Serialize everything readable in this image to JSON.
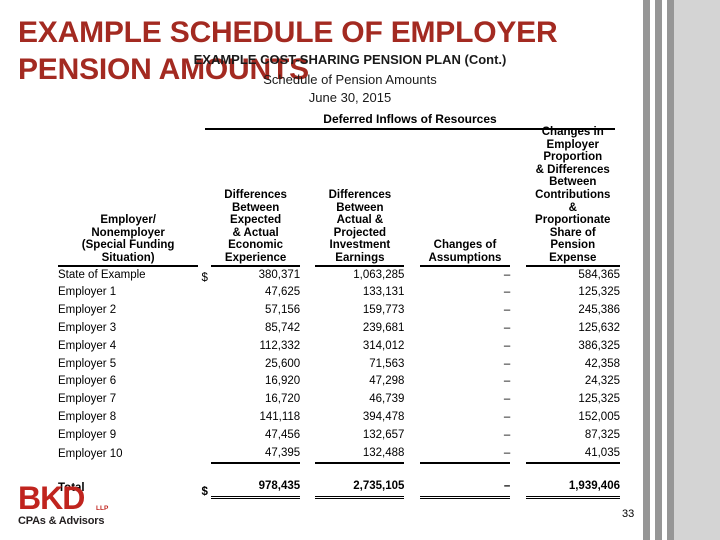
{
  "slide": {
    "title": "EXAMPLE SCHEDULE OF EMPLOYER PENSION AMOUNTS",
    "page_number": "33",
    "accent_color": "#A32A21",
    "bar_color": "#969696",
    "panel_color": "#d4d4d4"
  },
  "subheader": {
    "line1": "EXAMPLE COST-SHARING PENSION PLAN (Cont.)",
    "line2": "Schedule of Pension Amounts",
    "line3": "June 30, 2015"
  },
  "table": {
    "group_header": "Deferred Inflows of Resources",
    "columns": [
      {
        "id": "employer",
        "lines": [
          "Employer/",
          "Nonemployer",
          "(Special Funding",
          "Situation)"
        ]
      },
      {
        "id": "econ",
        "lines": [
          "Differences",
          "Between",
          "Expected",
          "& Actual",
          "Economic",
          "Experience"
        ]
      },
      {
        "id": "invest",
        "lines": [
          "Differences",
          "Between",
          "Actual &",
          "Projected",
          "Investment",
          "Earnings"
        ]
      },
      {
        "id": "assumptions",
        "lines": [
          "Changes of",
          "Assumptions"
        ]
      },
      {
        "id": "proportion",
        "lines": [
          "Changes in",
          "Employer",
          "Proportion",
          "& Differences",
          "Between",
          "Contributions",
          "&",
          "Proportionate",
          "Share of",
          "Pension",
          "Expense"
        ]
      }
    ],
    "currency_symbol": "$",
    "rows": [
      {
        "label": "State of Example",
        "currency": "$",
        "econ": "380,371",
        "invest": "1,063,285",
        "assumptions": "–",
        "proportion": "584,365"
      },
      {
        "label": "Employer 1",
        "currency": "",
        "econ": "47,625",
        "invest": "133,131",
        "assumptions": "–",
        "proportion": "125,325"
      },
      {
        "label": "Employer 2",
        "currency": "",
        "econ": "57,156",
        "invest": "159,773",
        "assumptions": "–",
        "proportion": "245,386"
      },
      {
        "label": "Employer 3",
        "currency": "",
        "econ": "85,742",
        "invest": "239,681",
        "assumptions": "–",
        "proportion": "125,632"
      },
      {
        "label": "Employer 4",
        "currency": "",
        "econ": "112,332",
        "invest": "314,012",
        "assumptions": "–",
        "proportion": "386,325"
      },
      {
        "label": "Employer 5",
        "currency": "",
        "econ": "25,600",
        "invest": "71,563",
        "assumptions": "–",
        "proportion": "42,358"
      },
      {
        "label": "Employer 6",
        "currency": "",
        "econ": "16,920",
        "invest": "47,298",
        "assumptions": "–",
        "proportion": "24,325"
      },
      {
        "label": "Employer 7",
        "currency": "",
        "econ": "16,720",
        "invest": "46,739",
        "assumptions": "–",
        "proportion": "125,325"
      },
      {
        "label": "Employer 8",
        "currency": "",
        "econ": "141,118",
        "invest": "394,478",
        "assumptions": "–",
        "proportion": "152,005"
      },
      {
        "label": "Employer 9",
        "currency": "",
        "econ": "47,456",
        "invest": "132,657",
        "assumptions": "–",
        "proportion": "87,325"
      },
      {
        "label": "Employer 10",
        "currency": "",
        "econ": "47,395",
        "invest": "132,488",
        "assumptions": "–",
        "proportion": "41,035"
      }
    ],
    "total": {
      "label": "Total",
      "currency": "$",
      "econ": "978,435",
      "invest": "2,735,105",
      "assumptions": "–",
      "proportion": "1,939,406"
    }
  },
  "logo": {
    "mark": "BKD",
    "suffix": "LLP",
    "tagline": "CPAs & Advisors"
  }
}
